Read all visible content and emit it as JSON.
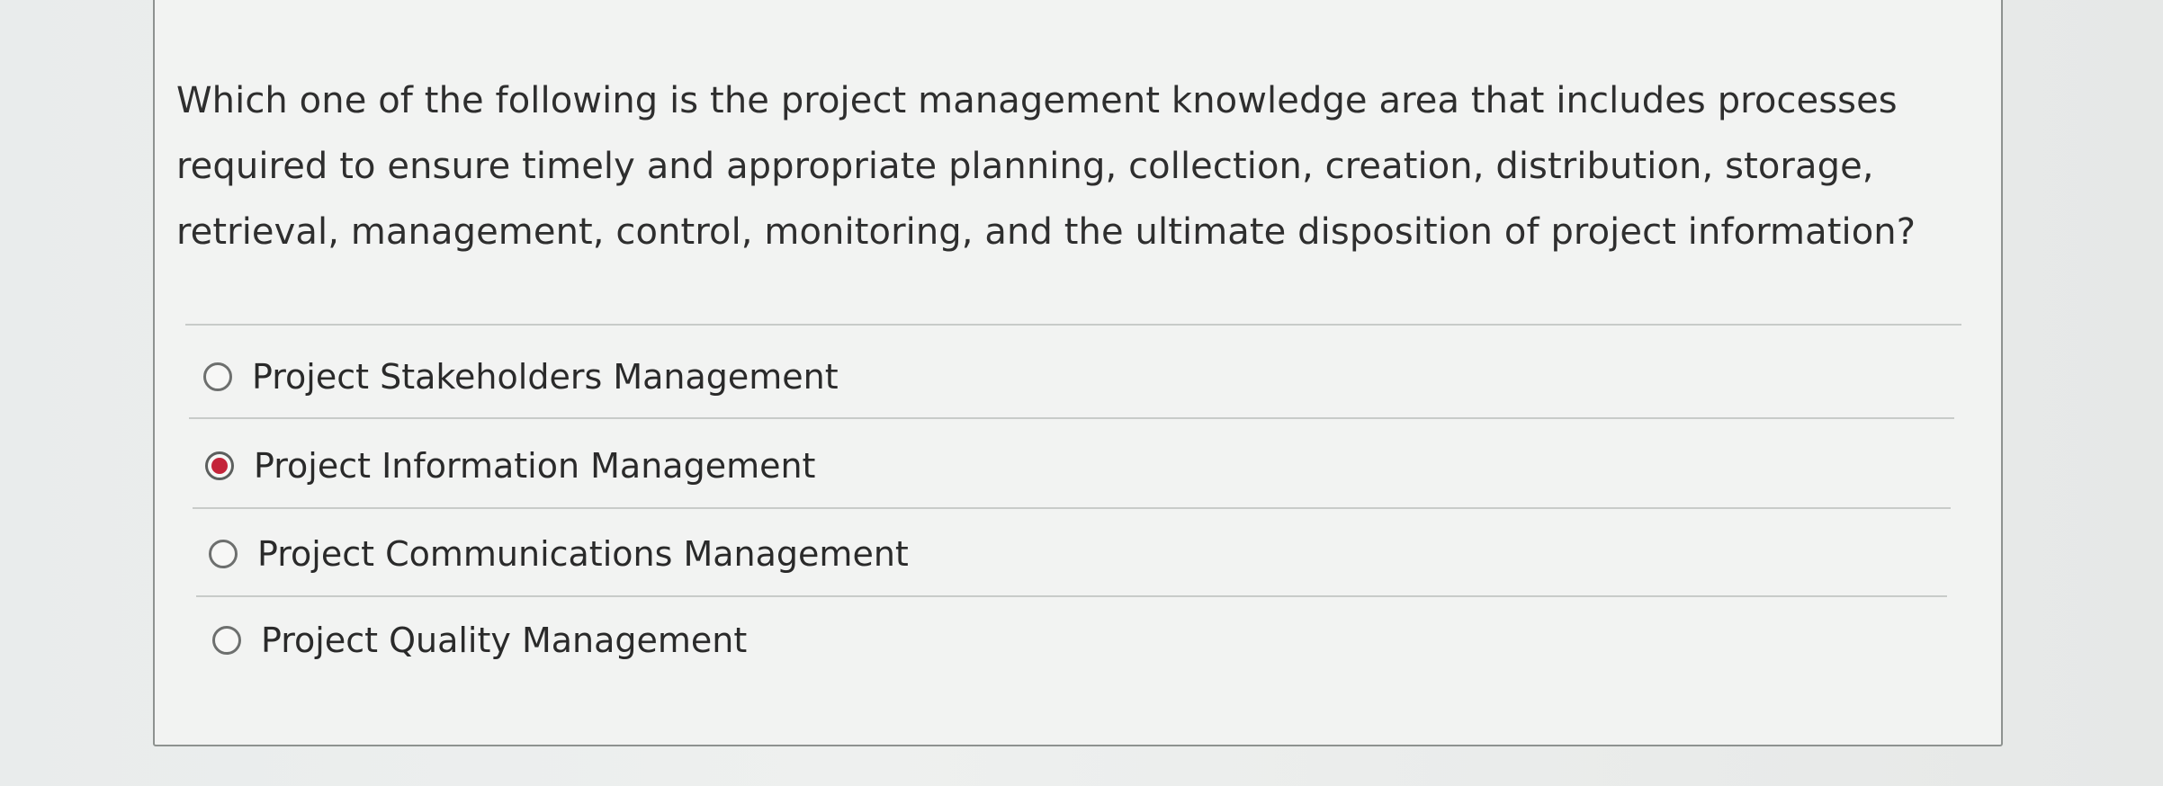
{
  "question": {
    "text": "Which one of the following is the project management knowledge area that includes processes\nrequired to ensure timely and appropriate planning, collection, creation, distribution, storage,\nretrieval, management, control, monitoring, and the ultimate disposition of project information?"
  },
  "options": [
    {
      "label": "Project Stakeholders Management",
      "selected": false
    },
    {
      "label": "Project Information Management",
      "selected": true
    },
    {
      "label": "Project Communications Management",
      "selected": false
    },
    {
      "label": "Project Quality Management",
      "selected": false
    }
  ],
  "colors": {
    "selected_radio": "#c4243a",
    "card_border": "#8e9290",
    "divider": "#c8cbc9"
  }
}
